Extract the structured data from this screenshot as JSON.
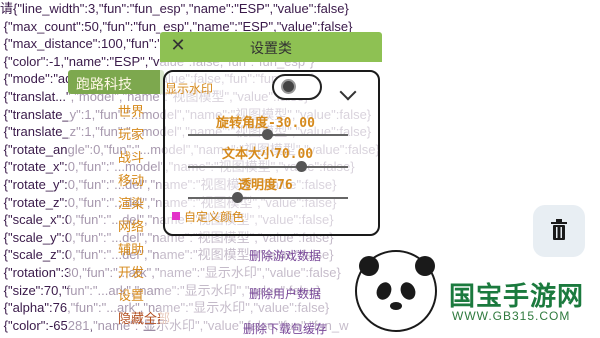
{
  "code_lines": [
    {
      "pre": "请{\"line_width\":3,\"fun\":\"fun_esp\",\"name\":\"ESP\",\"value\":false}",
      "y": 0
    },
    {
      "pre": " {\"max_count\":50,\"fun\":\"fun_esp\",\"name\":\"ESP\",\"value\":false}",
      "y": 1
    },
    {
      "pre": " {\"max_distance\":100,\"fun\":\"fun_esp\",\"name\":\"ESP\",\"value\":false}",
      "y": 2
    },
    {
      "pre": " {\"color\":-1,\"name\":\"ESP\",\"value\":false,\"fun\":\"fun_esp\"}",
      "y": 3
    },
    {
      "pre": " {\"mode\":\"ad\",\"name\":\"...\",\"value\":false,\"fun\":\"fun_esp\"}",
      "y": 4
    },
    {
      "pre": " {\"translat...\",\"model\",\"name\":\"视图模型\",\"value\":false}",
      "y": 5
    },
    {
      "pre": " {\"translate_y\":1,\"fun\":\"...model\",\"name\":\"视图模型\",\"value\":false}",
      "y": 6
    },
    {
      "pre": " {\"translate_z\":1,\"fun\":\"...model\",\"name\":\"视图模型\",\"value\":false}",
      "y": 7
    },
    {
      "pre": " {\"rotate_angle\":0,\"fun\":\"...model\",\"name\":\"视图模型\",\"value\":false}",
      "y": 8
    },
    {
      "pre": " {\"rotate_x\":0,\"fun\":\"...model\",\"name\":\"视图模型\",\"value\":false}",
      "y": 9
    },
    {
      "pre": " {\"rotate_y\":0,\"fun\":\"...del\",\"name\":\"视图模型\",\"value\":false}",
      "y": 10
    },
    {
      "pre": " {\"rotate_z\":0,\"fun\":\"...del\",\"name\":\"视图模型\",\"value\":false}",
      "y": 11
    },
    {
      "pre": " {\"scale_x\":0,\"fun\":\"...del\",\"name\":\"视图模型\",\"value\":false}",
      "y": 12
    },
    {
      "pre": " {\"scale_y\":0,\"fun\":\"...del\",\"name\":\"视图模型\",\"value\":false}",
      "y": 13
    },
    {
      "pre": " {\"scale_z\":0,\"fun\":\"...del\",\"name\":\"视图模型\",\"value\":false}",
      "y": 14
    },
    {
      "pre": " {\"rotation\":30,\"fun\":\"...ark\",\"name\":\"显示水印\",\"value\":false}",
      "y": 15
    },
    {
      "pre": " {\"size\":70,\"fun\":\"...ark\",\"name\":\"显示水印\",\"value\":false}",
      "y": 16
    },
    {
      "pre": " {\"alpha\":76,\"fun\":\"...ark\",\"name\":\"显示水印\",\"value\":false}",
      "y": 17
    },
    {
      "pre": " {\"color\":-65281,\"name\":\"显示水印\",\"value\":false,\"fun\":\"fun_w",
      "y": 18
    }
  ],
  "menu": {
    "title": "跑路科技",
    "items": [
      "世界",
      "玩家",
      "战斗",
      "移动",
      "渲染",
      "网络",
      "辅助",
      "开发",
      "设置",
      "隐藏全部"
    ]
  },
  "panel": {
    "title": "设置类",
    "watermark_label": "显示水印",
    "toggle_on": false,
    "sliders": [
      {
        "label": "旋转角度-30.00",
        "value": -30.0
      },
      {
        "label": "文本大小70.00",
        "value": 70.0
      },
      {
        "label": "透明度76",
        "value": 76
      }
    ],
    "custom_color_label": "自定义颜色",
    "custom_color": "#e333c9",
    "actions": [
      "删除游戏数据",
      "删除用户数据",
      "删除下载包缓存"
    ]
  },
  "brand": {
    "name": "国宝手游网",
    "url": "WWW.GB315.COM"
  },
  "colors": {
    "accent_green": "#8ec153",
    "menu_orange": "#d68a1c",
    "action_purple": "#7a4a9a"
  },
  "icons": {
    "trash": "trash-icon",
    "close": "close-icon",
    "chevron": "chevron-down-icon"
  }
}
